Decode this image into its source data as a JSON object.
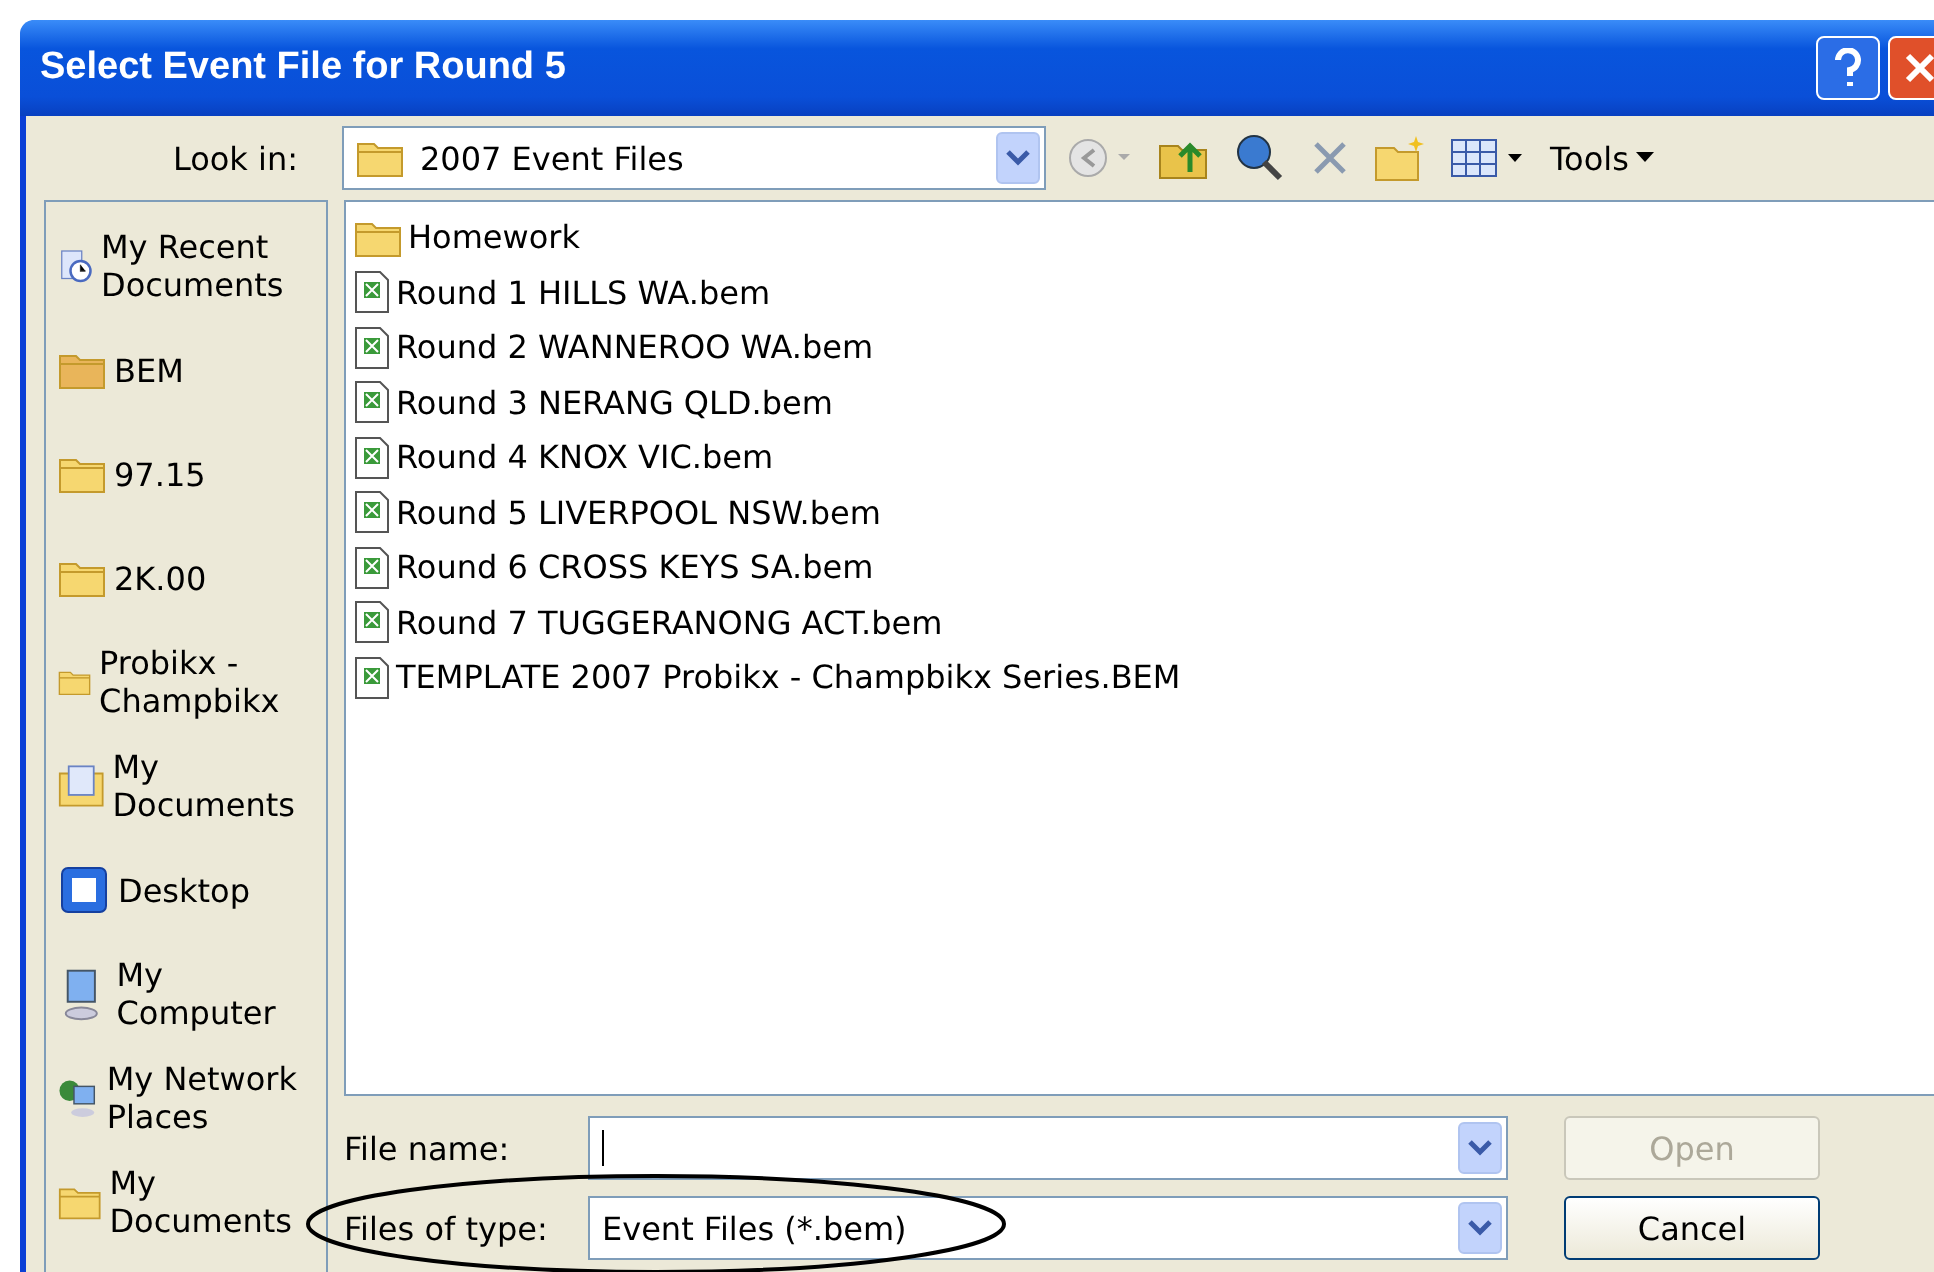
{
  "window": {
    "title": "Select Event File for Round 5"
  },
  "toolbar": {
    "look_in_label": "Look in:",
    "look_in_value": "2007 Event Files",
    "tools_label": "Tools"
  },
  "places": [
    {
      "label": "My Recent Documents",
      "kind": "recent"
    },
    {
      "label": "BEM",
      "kind": "folder-open"
    },
    {
      "label": "97.15",
      "kind": "folder"
    },
    {
      "label": "2K.00",
      "kind": "folder"
    },
    {
      "label": "Probikx - Champbikx",
      "kind": "folder"
    },
    {
      "label": "My Documents",
      "kind": "documents"
    },
    {
      "label": "Desktop",
      "kind": "desktop"
    },
    {
      "label": "My Computer",
      "kind": "computer"
    },
    {
      "label": "My Network Places",
      "kind": "network"
    },
    {
      "label": "My Documents",
      "kind": "folder"
    }
  ],
  "files": [
    {
      "name": "Homework",
      "kind": "folder"
    },
    {
      "name": "Round 1 HILLS WA.bem",
      "kind": "file"
    },
    {
      "name": "Round 2 WANNEROO WA.bem",
      "kind": "file"
    },
    {
      "name": "Round 3 NERANG QLD.bem",
      "kind": "file"
    },
    {
      "name": "Round 4 KNOX VIC.bem",
      "kind": "file"
    },
    {
      "name": "Round 5 LIVERPOOL NSW.bem",
      "kind": "file"
    },
    {
      "name": "Round 6 CROSS KEYS SA.bem",
      "kind": "file"
    },
    {
      "name": "Round 7 TUGGERANONG ACT.bem",
      "kind": "file"
    },
    {
      "name": "TEMPLATE 2007 Probikx - Champbikx Series.BEM",
      "kind": "file"
    }
  ],
  "file_name": {
    "label": "File name:"
  },
  "file_type": {
    "label": "Files of type:",
    "value": "Event Files (*.bem)"
  },
  "buttons": [
    {
      "label": "Open",
      "disabled": true
    },
    {
      "label": "Cancel",
      "disabled": false
    }
  ]
}
